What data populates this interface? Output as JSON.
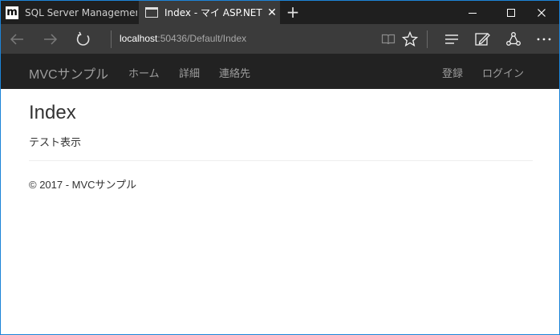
{
  "tabs": [
    {
      "title": "SQL Server Management Studio",
      "icon": "m-app-icon",
      "active": false
    },
    {
      "title": "Index - マイ ASP.NET アプリケーション",
      "icon": "page-icon",
      "active": true
    }
  ],
  "tab_close_glyph": "✕",
  "new_tab_glyph": "+",
  "address": {
    "host": "localhost",
    "path": ":50436/Default/Index"
  },
  "site": {
    "brand": "MVCサンプル",
    "nav_left": [
      "ホーム",
      "詳細",
      "連絡先"
    ],
    "nav_right": [
      "登録",
      "ログイン"
    ]
  },
  "page": {
    "title": "Index",
    "text": "テスト表示",
    "footer": "© 2017 - MVCサンプル"
  },
  "colors": {
    "tabbar": "#1f1f1f",
    "active_tab": "#3b3b3b",
    "navbar": "#222222",
    "window_border": "#1c84d8"
  }
}
